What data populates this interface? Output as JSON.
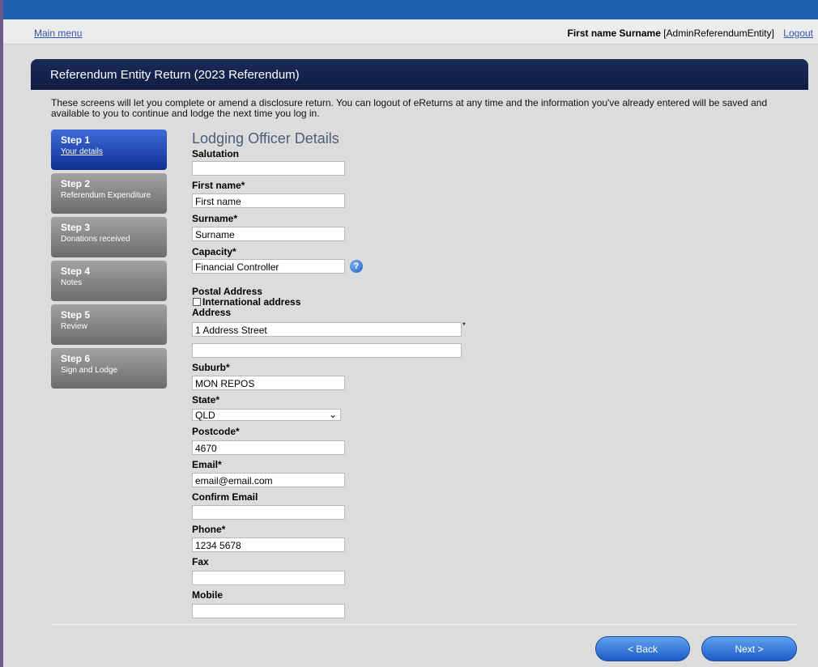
{
  "header": {
    "main_menu": "Main menu",
    "user_name": "First name Surname",
    "user_role": "[AdminReferendumEntity]",
    "logout": "Logout"
  },
  "panel": {
    "title": "Referendum Entity Return (2023 Referendum)",
    "intro": "These screens will let you complete or amend a disclosure return. You can logout of eReturns at any time and the information you've already entered will be saved and available to you to continue and lodge the next time you log in."
  },
  "steps": [
    {
      "num": "Step 1",
      "label": "Your details"
    },
    {
      "num": "Step 2",
      "label": "Referendum Expenditure"
    },
    {
      "num": "Step 3",
      "label": "Donations received"
    },
    {
      "num": "Step 4",
      "label": "Notes"
    },
    {
      "num": "Step 5",
      "label": "Review"
    },
    {
      "num": "Step 6",
      "label": "Sign and Lodge"
    }
  ],
  "form": {
    "title": "Lodging Officer Details",
    "salutation": {
      "label": "Salutation",
      "value": ""
    },
    "first_name": {
      "label": "First name*",
      "value": "First name"
    },
    "surname": {
      "label": "Surname*",
      "value": "Surname"
    },
    "capacity": {
      "label": "Capacity*",
      "value": "Financial Controller"
    },
    "postal_address": {
      "label": "Postal Address"
    },
    "international": {
      "label": "International address"
    },
    "address": {
      "label": "Address",
      "line1": "1 Address Street",
      "line2": "",
      "required": "*"
    },
    "suburb": {
      "label": "Suburb*",
      "value": "MON REPOS"
    },
    "state": {
      "label": "State*",
      "value": "QLD"
    },
    "postcode": {
      "label": "Postcode*",
      "value": "4670"
    },
    "email": {
      "label": "Email*",
      "value": "email@email.com"
    },
    "confirm_email": {
      "label": "Confirm Email",
      "value": ""
    },
    "phone": {
      "label": "Phone*",
      "value": "1234 5678"
    },
    "fax": {
      "label": "Fax",
      "value": ""
    },
    "mobile": {
      "label": "Mobile",
      "value": ""
    }
  },
  "buttons": {
    "back": "< Back",
    "next": "Next >"
  },
  "colors": {
    "accent": "#1d5cc9",
    "panel_header": "#15244d",
    "active_step": "#1f48b8",
    "inactive_step": "#8a8a8a"
  }
}
